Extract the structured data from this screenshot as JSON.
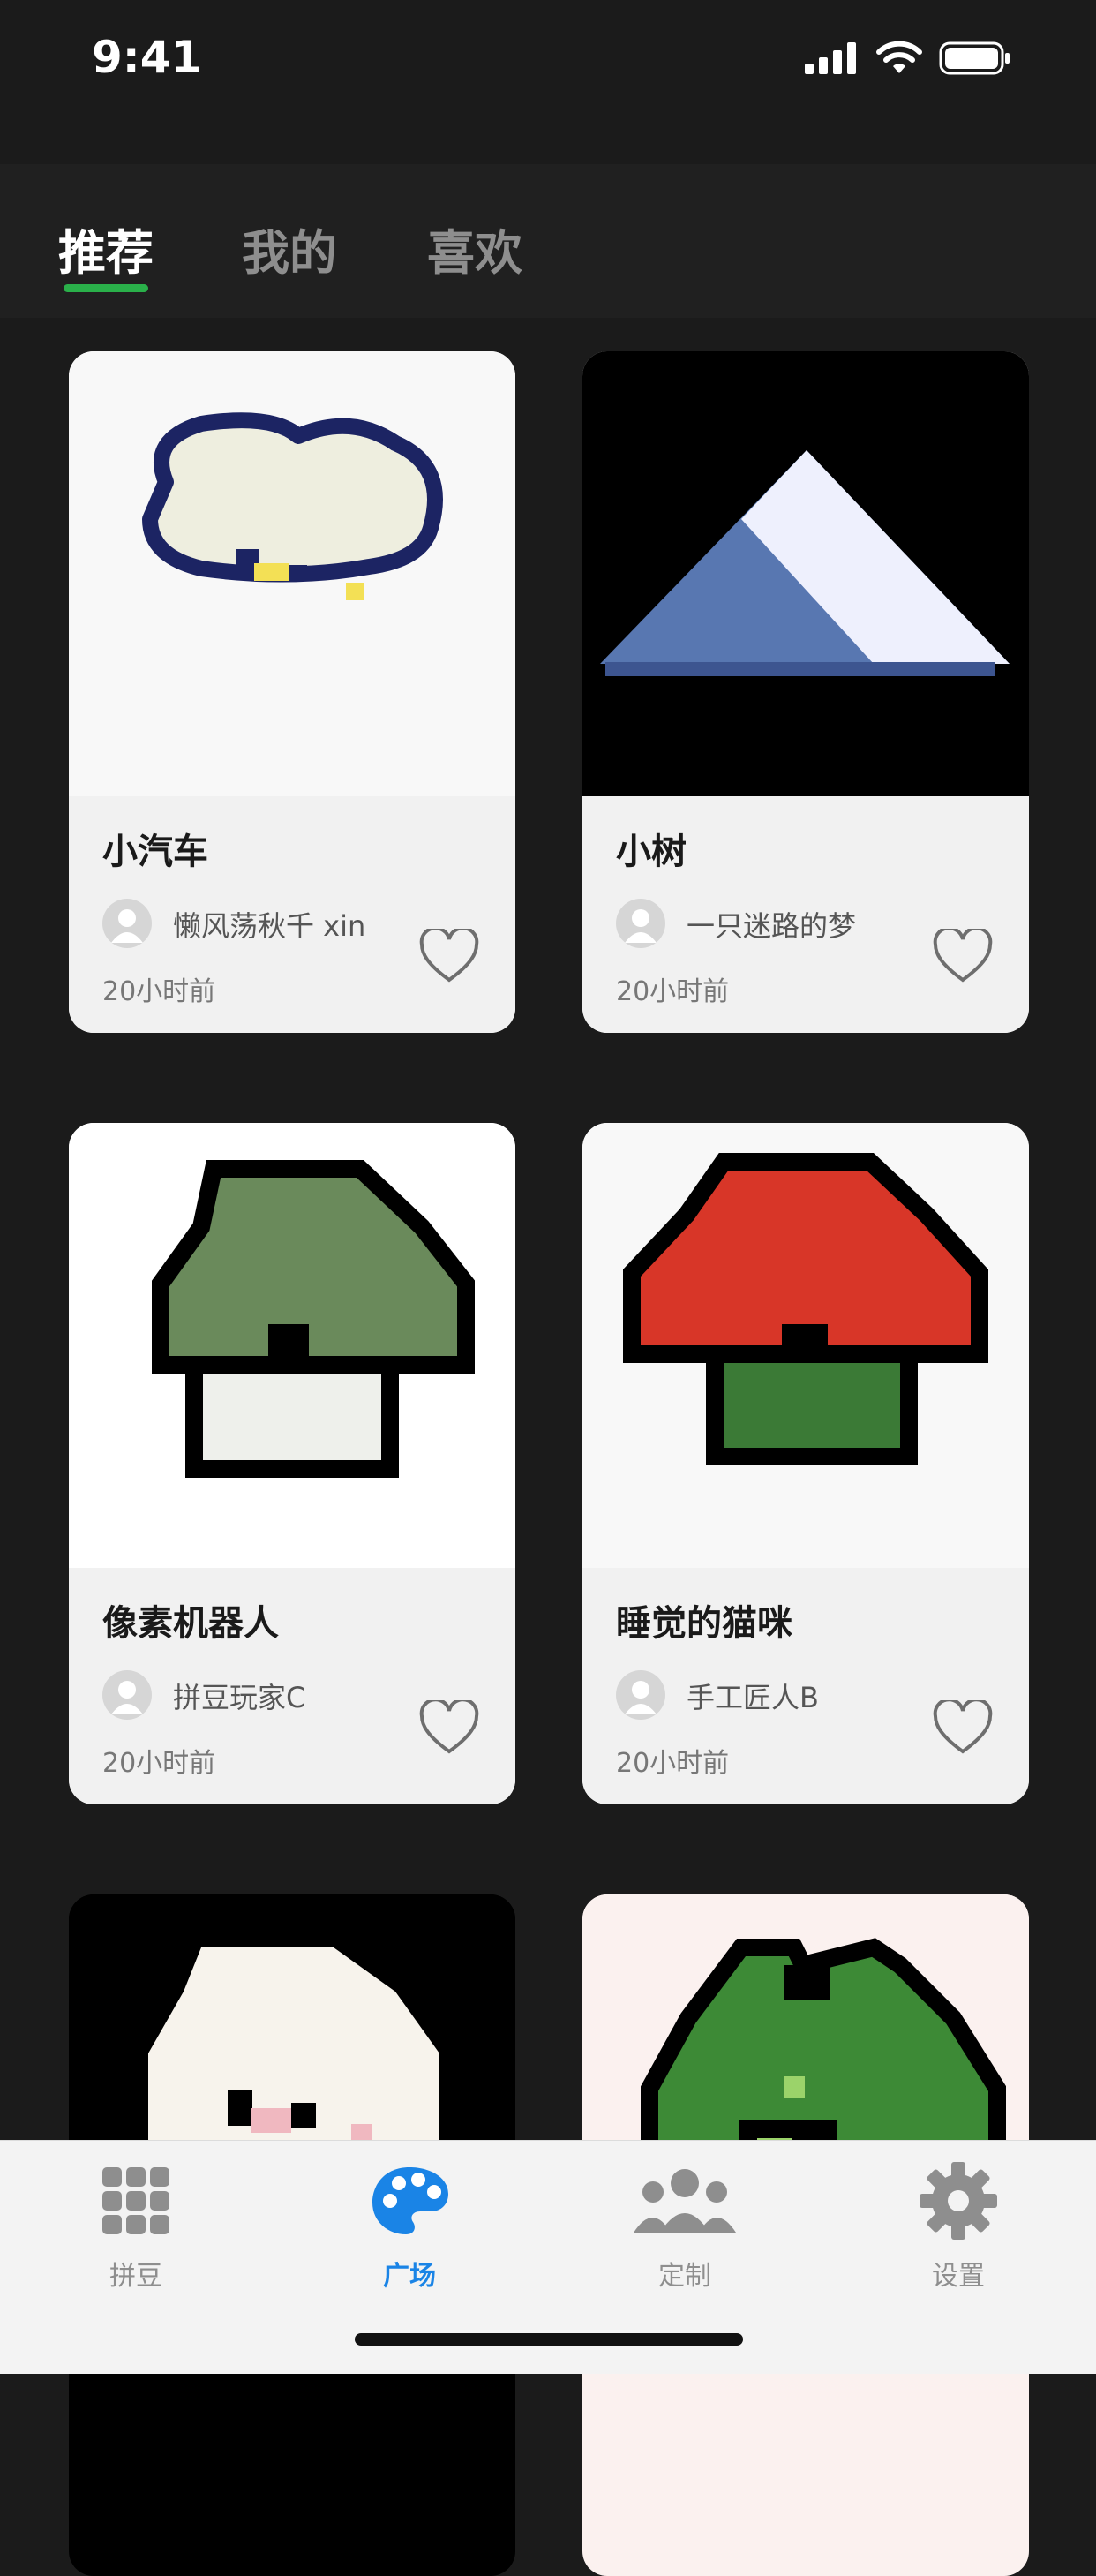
{
  "status_bar": {
    "time": "9:41",
    "icons": [
      "signal-icon",
      "wifi-icon",
      "battery-icon"
    ]
  },
  "tabs": [
    {
      "label": "推荐",
      "active": true
    },
    {
      "label": "我的",
      "active": false
    },
    {
      "label": "喜欢",
      "active": false
    }
  ],
  "cards": [
    {
      "title": "小汽车",
      "author": "懒风荡秋千 xin",
      "time": "20小时前",
      "liked": false
    },
    {
      "title": "小树",
      "author": "一只迷路的梦",
      "time": "20小时前",
      "liked": false
    },
    {
      "title": "像素机器人",
      "author": "拼豆玩家C",
      "time": "20小时前",
      "liked": false
    },
    {
      "title": "睡觉的猫咪",
      "author": "手工匠人B",
      "time": "20小时前",
      "liked": false
    },
    {
      "title": "",
      "author": "",
      "time": "",
      "liked": false
    },
    {
      "title": "",
      "author": "",
      "time": "",
      "liked": false
    }
  ],
  "tabbar": [
    {
      "label": "拼豆",
      "icon": "grid-icon",
      "active": false
    },
    {
      "label": "广场",
      "icon": "palette-icon",
      "active": true
    },
    {
      "label": "定制",
      "icon": "people-icon",
      "active": false
    },
    {
      "label": "设置",
      "icon": "gear-icon",
      "active": false
    }
  ],
  "colors": {
    "accent_green": "#2ab04a",
    "accent_blue": "#1a84e6",
    "background": "#1b1b1b"
  }
}
